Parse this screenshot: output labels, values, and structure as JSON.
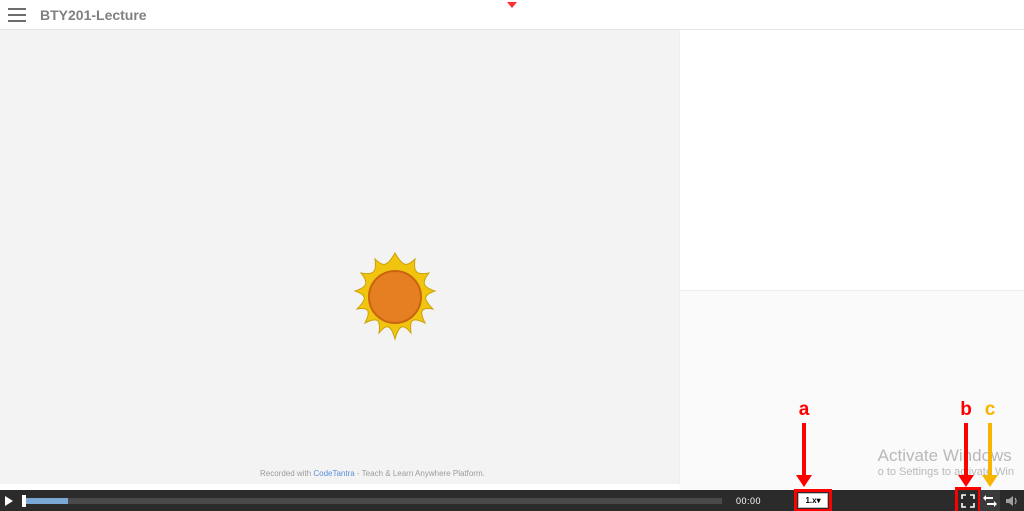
{
  "header": {
    "title": "BTY201-Lecture"
  },
  "video": {
    "recorded_prefix": "Recorded with ",
    "recorded_brand": "CodeTantra",
    "recorded_suffix": " - Teach & Learn Anywhere Platform."
  },
  "controls": {
    "time": "00:00",
    "speed": "1.x▾"
  },
  "watermark": {
    "line1": "Activate Windows",
    "line2": "o to Settings to activate Win"
  },
  "annotations": {
    "a": "a",
    "b": "b",
    "c": "c"
  }
}
